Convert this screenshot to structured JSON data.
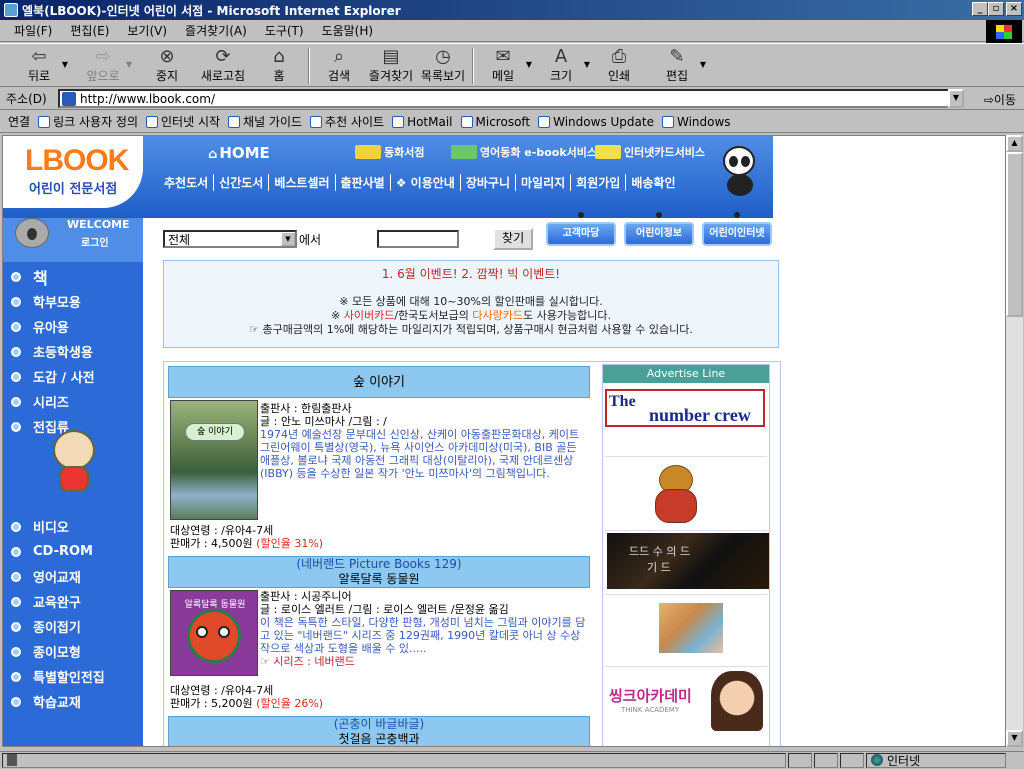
{
  "window": {
    "title": "엘북(LBOOK)-인터넷 어린이 서점 - Microsoft Internet Explorer"
  },
  "menu": [
    "파일(F)",
    "편집(E)",
    "보기(V)",
    "즐겨찾기(A)",
    "도구(T)",
    "도움말(H)"
  ],
  "toolbar": {
    "back": "뒤로",
    "forward": "앞으로",
    "stop": "중지",
    "refresh": "새로고침",
    "home": "홈",
    "search": "검색",
    "favorites": "즐겨찾기",
    "history": "목록보기",
    "mail": "메일",
    "size": "크기",
    "print": "인쇄",
    "edit": "편집"
  },
  "address": {
    "label": "주소(D)",
    "url": "http://www.lbook.com/",
    "go": "이동"
  },
  "links": {
    "label": "연결",
    "items": [
      "링크 사용자 정의",
      "인터넷 시작",
      "채널 가이드",
      "추천 사이트",
      "HotMail",
      "Microsoft",
      "Windows Update",
      "Windows"
    ]
  },
  "status": {
    "zone": "인터넷"
  },
  "site": {
    "logo": "LBOOK",
    "logo_sub": "어린이 전문서점",
    "home": "HOME",
    "services": [
      "동화서점",
      "영어동화 e-book서비스",
      "인터넷카드서비스"
    ],
    "nav": [
      "추천도서",
      "신간도서",
      "베스트셀러",
      "출판사별",
      "❖ 이용안내",
      "장바구니",
      "마일리지",
      "회원가입",
      "배송확인"
    ],
    "welcome": "WELCOME",
    "login": "로그인",
    "tabs": [
      "고객마당",
      "어린이정보",
      "어린이인터넷"
    ],
    "search": {
      "select": "전체",
      "label": "에서",
      "button": "찾기"
    },
    "sidebar_top": [
      "책",
      "학부모용",
      "유아용",
      "초등학생용",
      "도감 / 사전",
      "시리즈",
      "전집류"
    ],
    "sidebar_bottom": [
      "비디오",
      "CD-ROM",
      "영어교재",
      "교육완구",
      "종이접기",
      "종이모형",
      "특별할인전집",
      "학습교재"
    ],
    "event": {
      "title": "1. 6월 이벤트!    2. 깜짝! 빅 이벤트!",
      "line1": "※ 모든 상품에 대해 10~30%의 할인판매를 실시합니다.",
      "line2_prefix": "※ ",
      "line2_card1": "사이버카드",
      "line2_mid": "/한국도서보급의 ",
      "line2_card2": "다사랑카드",
      "line2_suffix": "도 사용가능합니다.",
      "line3": "☞ 총구매금액의 1%에 해당하는 마일리지가 적립되며, 상품구매시 현금처럼 사용할 수 있습니다."
    },
    "books": [
      {
        "title": "숲 이야기",
        "cover_text": "숲 이야기",
        "publisher": "출판사 : 한림출판사",
        "author": "글 : 안노 미쓰마사 /그림 : /",
        "desc": "1974년 예술선장 문부대신 신인상, 산케이 아동출판문화대상, 케이트 그린어웨이 특별상(영국), 뉴욕 사이언스 아카데미상(미국), BIB 골든 애플상, 볼로냐 국제 아동전 그래픽 대상(이탈리아), 국제 안데르센상(IBBY) 등을 수상한 일본 작가 '안노 미쯔마사'의 그림책입니다.",
        "age": "대상연령 : /유아4-7세",
        "price": "판매가 : 4,500원",
        "discount": "(할인율 31%)"
      },
      {
        "series_label": "(네버랜드 Picture Books 129)",
        "title": "알록달록 동물원",
        "cover_text": "알록달록 동물원",
        "publisher": "출판사 : 시공주니어",
        "author": "글 : 로이스 엘러트 /그림 : 로이스 엘러트 /문정윤 옮김",
        "desc": "이 책은 독특한 스타일, 다양한 판형, 개성미 넘치는 그림과 이야기를 담고 있는 \"네버랜드\" 시리즈 중 129권째, 1990년 칼데콧 아너 상 수상작으로 색상과 도형을 배울 수 있.....",
        "series": "☞ 시리즈 : 네버랜드",
        "age": "대상연령 : /유아4-7세",
        "price": "판매가 : 5,200원",
        "discount": "(할인율 26%)"
      },
      {
        "series_label": "(곤충이 바글바글)",
        "title": "첫걸음 곤충백과"
      }
    ],
    "ads": {
      "header": "Advertise Line",
      "numbercrew_a": "The",
      "numbercrew_b": "number crew",
      "dark_a": "드드 수 의 드",
      "dark_b": "기 드",
      "sink": "씽크아카데미",
      "sink_sub": "THINK ACADEMY"
    }
  }
}
